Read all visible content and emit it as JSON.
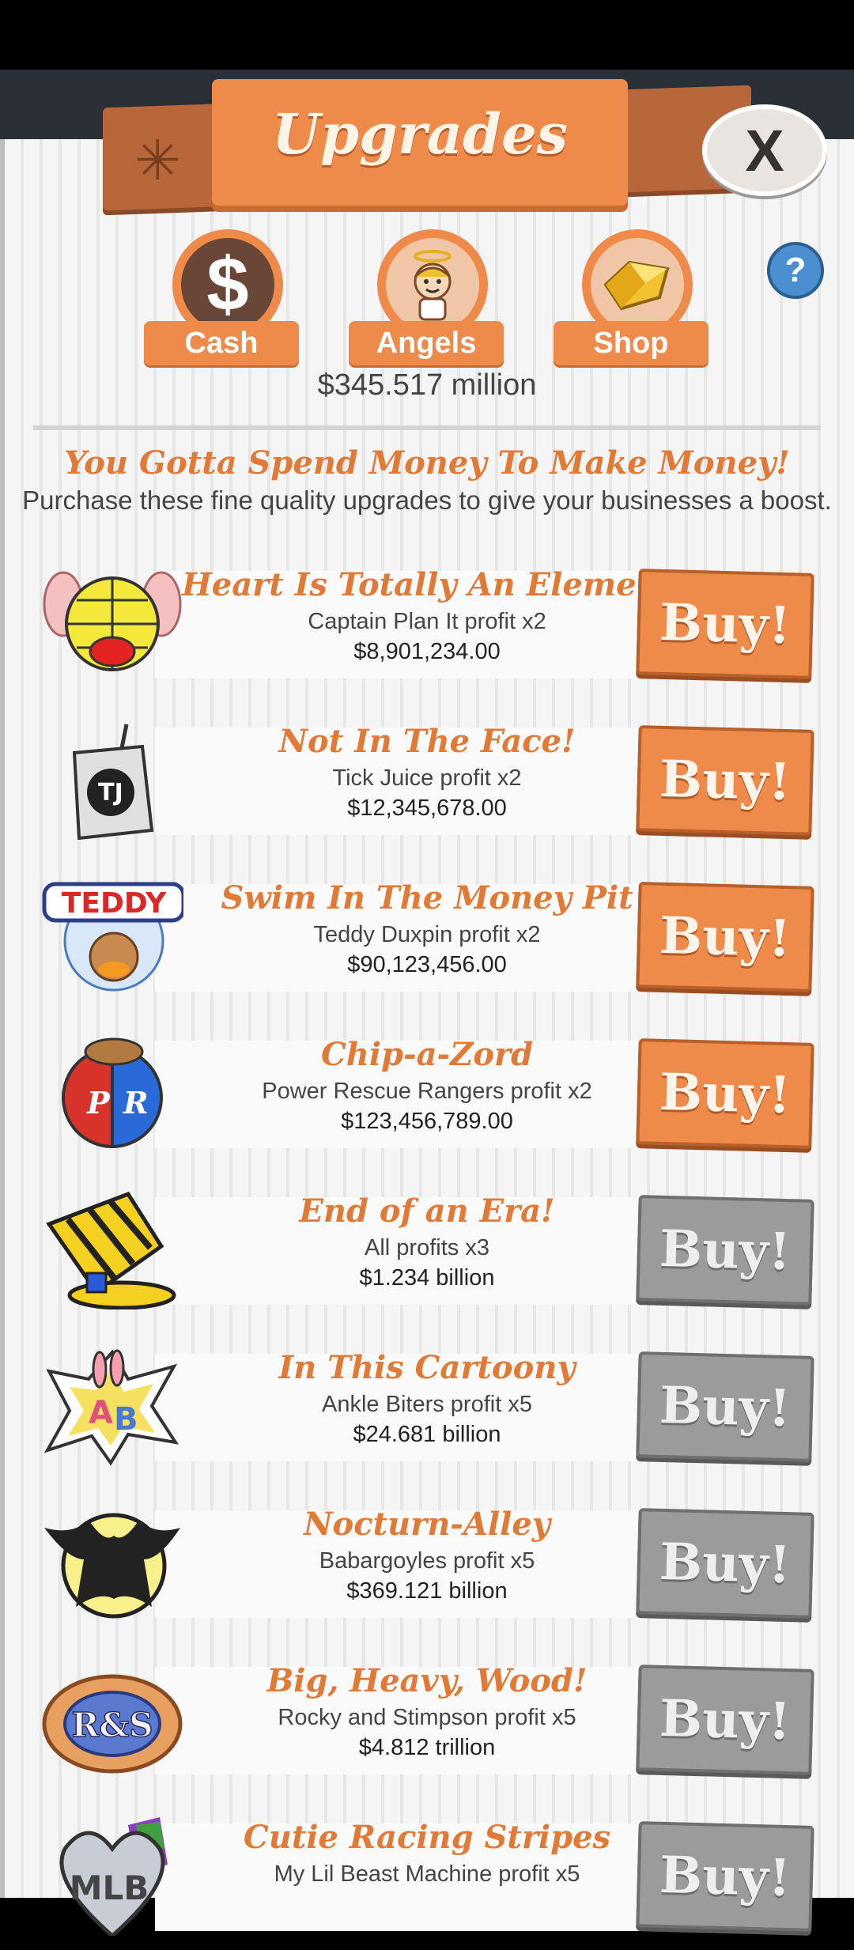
{
  "header": {
    "title": "Upgrades",
    "close_label": "X"
  },
  "tabs": [
    {
      "label": "Cash",
      "icon": "dollar-icon"
    },
    {
      "label": "Angels",
      "icon": "angel-icon"
    },
    {
      "label": "Shop",
      "icon": "gold-gem-icon"
    }
  ],
  "help_label": "?",
  "balance": "$345.517 million",
  "headline": "You Gotta Spend Money To Make Money!",
  "subline": "Purchase these fine quality upgrades to give your businesses a boost.",
  "buy_label": "Buy!",
  "colors": {
    "accent": "#ee8a4a",
    "disabled": "#9b9b9b",
    "title_text": "#e07a36"
  },
  "upgrades": [
    {
      "name": "Heart Is Totally An Element",
      "desc": "Captain Plan It profit x2",
      "price": "$8,901,234.00",
      "affordable": true,
      "icon": "planet-globe-icon"
    },
    {
      "name": "Not In The Face!",
      "desc": "Tick Juice profit x2",
      "price": "$12,345,678.00",
      "affordable": true,
      "icon": "juice-box-icon"
    },
    {
      "name": "Swim In The Money Pit",
      "desc": "Teddy Duxpin profit x2",
      "price": "$90,123,456.00",
      "affordable": true,
      "icon": "teddy-bear-icon"
    },
    {
      "name": "Chip-a-Zord",
      "desc": "Power Rescue Rangers profit x2",
      "price": "$123,456,789.00",
      "affordable": true,
      "icon": "rescue-rangers-icon"
    },
    {
      "name": "End of an Era!",
      "desc": "All profits x3",
      "price": "$1.234 billion",
      "affordable": false,
      "icon": "striped-hat-icon"
    },
    {
      "name": "In This Cartoony",
      "desc": "Ankle Biters profit x5",
      "price": "$24.681 billion",
      "affordable": false,
      "icon": "bunny-badge-icon"
    },
    {
      "name": "Nocturn-Alley",
      "desc": "Babargoyles profit x5",
      "price": "$369.121 billion",
      "affordable": false,
      "icon": "gargoyle-moon-icon"
    },
    {
      "name": "Big, Heavy, Wood!",
      "desc": "Rocky and Stimpson profit x5",
      "price": "$4.812 trillion",
      "affordable": false,
      "icon": "rocky-stimpson-icon"
    },
    {
      "name": "Cutie Racing Stripes",
      "desc": "My Lil Beast Machine profit x5",
      "price": "",
      "affordable": false,
      "icon": "mlb-heart-icon"
    }
  ]
}
